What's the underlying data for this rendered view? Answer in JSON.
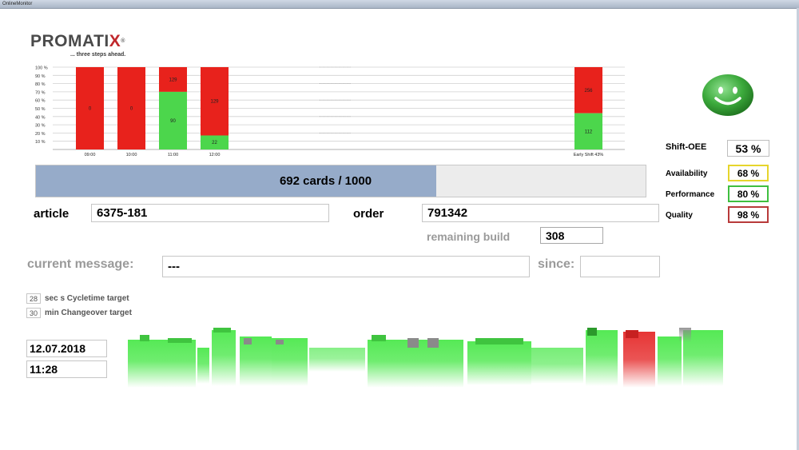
{
  "window": {
    "title": "OnlineMonitor"
  },
  "logo": {
    "name": "PROMATIX",
    "tagline": "... three steps ahead."
  },
  "chart_data": {
    "type": "bar",
    "stacked": true,
    "y_ticks": [
      "100 %",
      "90 %",
      "80 %",
      "70 %",
      "60 %",
      "50 %",
      "40 %",
      "30 %",
      "20 %",
      "10 %"
    ],
    "ylim": [
      0,
      100
    ],
    "categories": [
      "09:00",
      "10:00",
      "11:00",
      "12:00",
      "Early Shift 43%"
    ],
    "series": [
      {
        "color": "#4cd64c",
        "percent": [
          0,
          0,
          70,
          17,
          44
        ],
        "labels": [
          "",
          "",
          "90",
          "22",
          "112"
        ]
      },
      {
        "color": "#e8221c",
        "percent": [
          100,
          100,
          30,
          83,
          56
        ],
        "labels": [
          "0",
          "0",
          "129",
          "129",
          "256"
        ]
      }
    ]
  },
  "status": {
    "icon": "smiley-icon",
    "color": "#3caa3c"
  },
  "kpis": {
    "shift_oee": {
      "label": "Shift-OEE",
      "value": "53 %"
    },
    "availability": {
      "label": "Availability",
      "value": "68 %",
      "color": "#e6d52c"
    },
    "performance": {
      "label": "Performance",
      "value": "80 %",
      "color": "#3fbf3f"
    },
    "quality": {
      "label": "Quality",
      "value": "98 %",
      "color": "#b83a3a"
    }
  },
  "progress": {
    "text": "692 cards / 1000",
    "fraction": 0.692
  },
  "article": {
    "label": "article",
    "value": "6375-181"
  },
  "order": {
    "label": "order",
    "value": "791342"
  },
  "remaining": {
    "label": "remaining build",
    "value": "308"
  },
  "message": {
    "label": "current message:",
    "value": "---",
    "since_label": "since:",
    "since_value": ""
  },
  "targets": {
    "cycletime": {
      "value": "28",
      "label": "sec s Cycletime target"
    },
    "changeover": {
      "value": "30",
      "label": "min Changeover target"
    }
  },
  "datetime": {
    "date": "12.07.2018",
    "time": "11:28"
  }
}
